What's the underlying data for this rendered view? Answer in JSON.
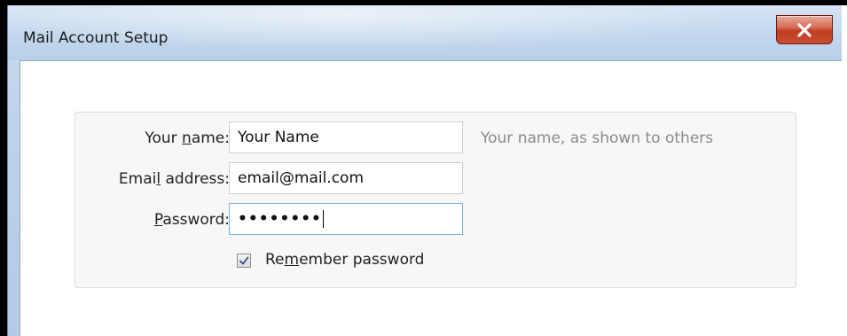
{
  "window": {
    "title": "Mail Account Setup",
    "close_icon": "close-icon"
  },
  "form": {
    "name": {
      "label_before": "Your ",
      "label_accel": "n",
      "label_after": "ame:",
      "value": "Your Name",
      "hint": "Your name, as shown to others"
    },
    "email": {
      "label_before": "Emai",
      "label_accel": "l",
      "label_after": " address:",
      "value": "email@mail.com"
    },
    "password": {
      "label_before": "",
      "label_accel": "P",
      "label_after": "assword:",
      "value": "••••••••"
    },
    "remember": {
      "label_before": "Re",
      "label_accel": "m",
      "label_after": "ember password",
      "checked": true
    }
  },
  "colors": {
    "close_button": "#c94f33",
    "focus_border": "#7eb4ea",
    "hint_text": "#8a8a8a"
  }
}
